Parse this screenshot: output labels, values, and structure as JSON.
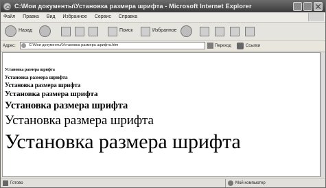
{
  "window": {
    "title": "C:\\Мои документы\\Установка размера шрифта - Microsoft Internet Explorer"
  },
  "menubar": {
    "items": [
      "Файл",
      "Правка",
      "Вид",
      "Избранное",
      "Сервис",
      "Справка"
    ]
  },
  "toolbar": {
    "back_label": "Назад",
    "search_label": "Поиск",
    "favorites_label": "Избранное"
  },
  "addressbar": {
    "label": "Адрес:",
    "value": "C:\\Мои документы\\Установка размера шрифта.htm",
    "go_label": "Переход",
    "links_label": "Ссылки"
  },
  "content": {
    "lines": [
      "Установка размера шрифта",
      "Установка размера шрифта",
      "Установка размера шрифта",
      "Установка размера шрифта",
      "Установка размера шрифта",
      "Установка размера шрифта",
      "Установка размера шрифта"
    ]
  },
  "statusbar": {
    "status": "Готово",
    "zone": "Мой компьютер"
  }
}
